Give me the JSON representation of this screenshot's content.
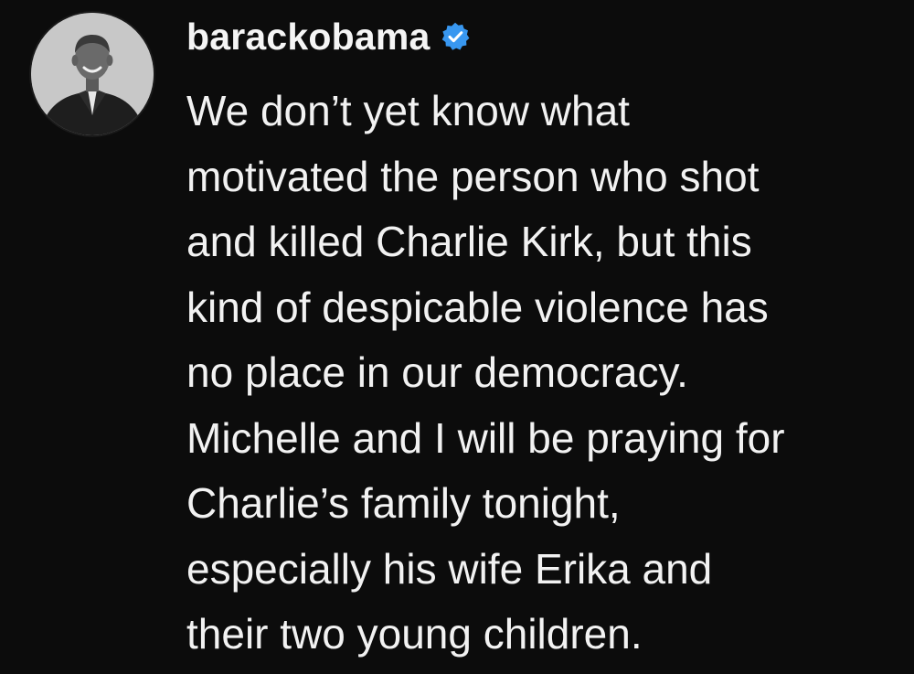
{
  "post": {
    "author": {
      "username": "barackobama",
      "verified": true,
      "verified_color": "#3897f0",
      "avatar_icon": "profile-photo"
    },
    "caption_lines": [
      "We don’t yet know what",
      "motivated the person who shot",
      "and killed Charlie Kirk, but this",
      "kind of despicable violence has",
      "no place in our democracy.",
      "Michelle and I will be praying for",
      "Charlie’s family tonight,",
      "especially his wife Erika and",
      "their two young children."
    ]
  }
}
